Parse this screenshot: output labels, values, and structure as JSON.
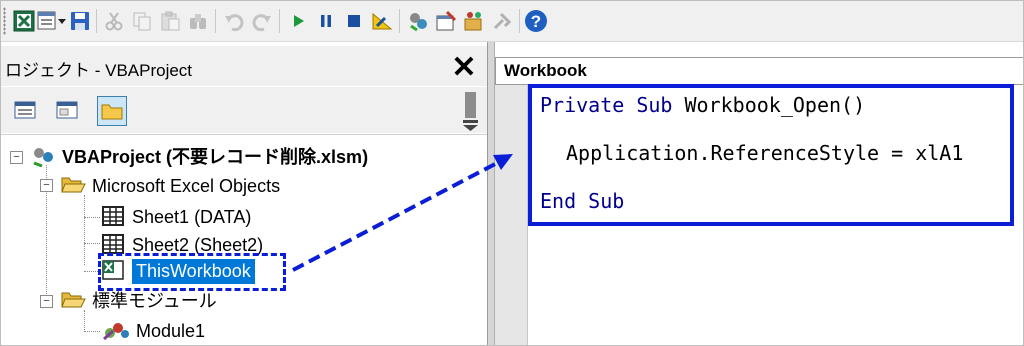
{
  "project_window": {
    "title": "プロジェクト - VBAProject",
    "title_visible_text": "ロジェクト - VBAProject",
    "close_symbol": "✕"
  },
  "tree": {
    "root": "VBAProject (不要レコード削除.xlsm)",
    "folder_excel": "Microsoft Excel Objects",
    "sheet1": "Sheet1 (DATA)",
    "sheet2": "Sheet2 (Sheet2)",
    "thisworkbook": "ThisWorkbook",
    "folder_modules": "標準モジュール",
    "module1": "Module1",
    "collapse_symbol": "−"
  },
  "code_window": {
    "object": "Workbook",
    "lines": {
      "line1_kw": "Private Sub",
      "line1_rest": " Workbook_Open()",
      "line2": "Application.ReferenceStyle = xlA1",
      "line3_kw": "End Sub"
    }
  },
  "colors": {
    "keyword": "#00008b",
    "annotation": "#0a1ed8",
    "selection": "#0078d7"
  }
}
